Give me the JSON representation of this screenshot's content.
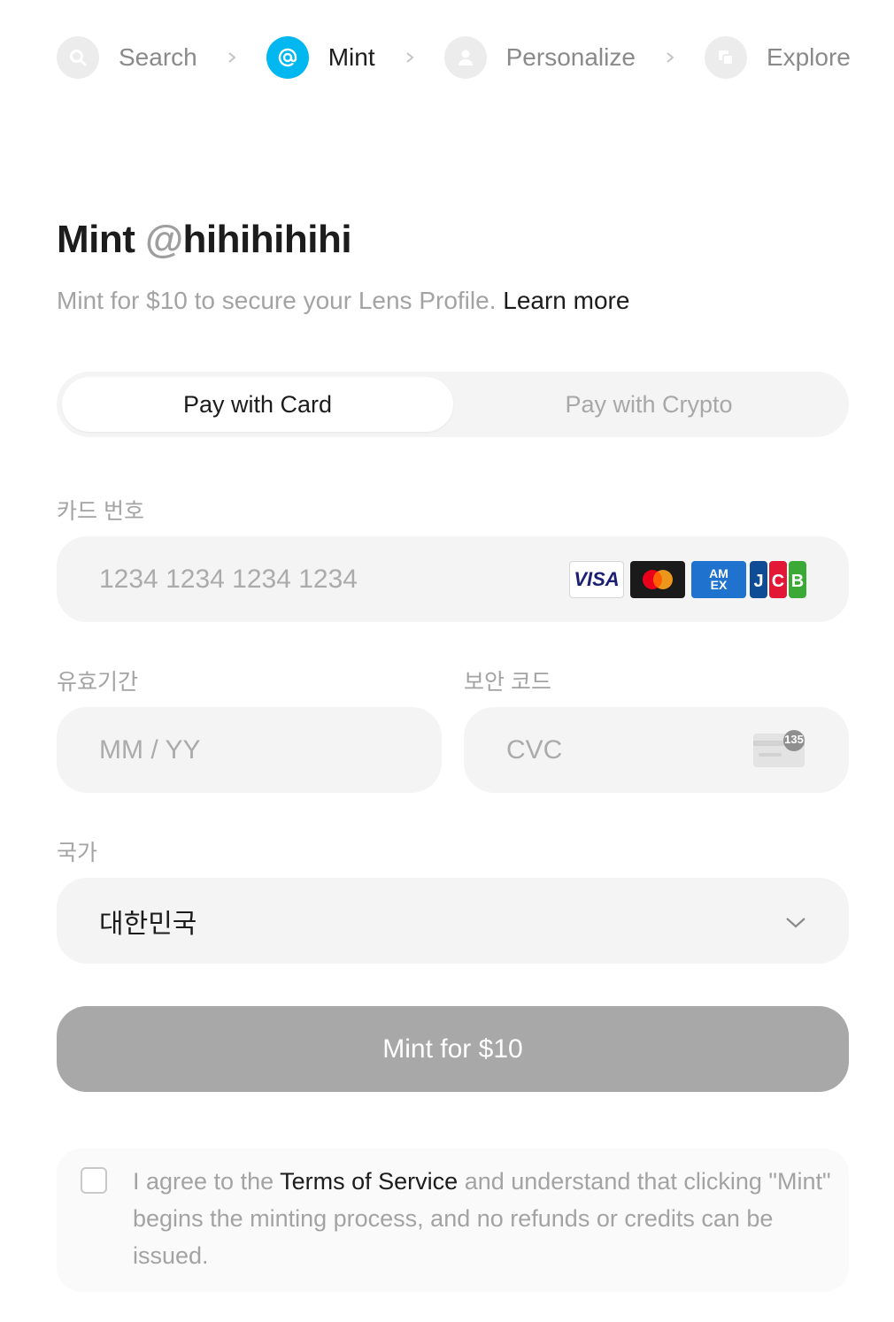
{
  "stepper": {
    "steps": [
      {
        "label": "Search",
        "icon": "search-icon",
        "active": false
      },
      {
        "label": "Mint",
        "icon": "at-icon",
        "active": true
      },
      {
        "label": "Personalize",
        "icon": "user-icon",
        "active": false
      },
      {
        "label": "Explore",
        "icon": "squares-icon",
        "active": false
      }
    ]
  },
  "heading": {
    "title_prefix": "Mint ",
    "title_handle": "@hihihihihi",
    "subtitle": "Mint for $10 to secure your Lens Profile. ",
    "learn_more": "Learn more"
  },
  "tabs": {
    "card": "Pay with Card",
    "crypto": "Pay with Crypto"
  },
  "form": {
    "card_number": {
      "label": "카드 번호",
      "placeholder": "1234 1234 1234 1234"
    },
    "card_brands": [
      "VISA",
      "Mastercard",
      "AMEX",
      "JCB"
    ],
    "expiry": {
      "label": "유효기간",
      "placeholder": "MM / YY"
    },
    "cvc": {
      "label": "보안 코드",
      "placeholder": "CVC",
      "icon_text": "135"
    },
    "country": {
      "label": "국가",
      "value": "대한민국"
    }
  },
  "mint_button": {
    "label": "Mint for $10"
  },
  "terms": {
    "prefix": "I agree to the ",
    "link": "Terms of Service",
    "suffix": " and understand that clicking \"Mint\" begins the minting process, and no refunds or credits can be issued."
  },
  "colors": {
    "accent": "#00b7f0",
    "button_disabled": "#a8a8a8",
    "field_bg": "#f4f4f4"
  }
}
